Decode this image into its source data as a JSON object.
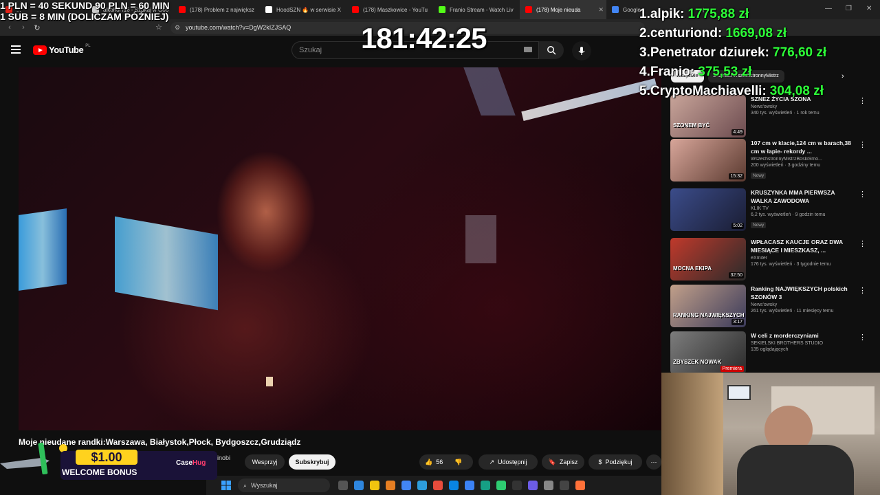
{
  "browser": {
    "tabs": [
      {
        "label": "...",
        "color": "#e62117",
        "active": false
      },
      {
        "label": "alkohol f16 - Szukaj w Goo",
        "color": "#cfcfcf",
        "active": false
      },
      {
        "label": "(178) Problem z największ",
        "color": "#ff0000",
        "active": false
      },
      {
        "label": "HoodSZN 🔥 w serwisie X",
        "color": "#ffffff",
        "active": false
      },
      {
        "label": "(178) Maszkowice - YouTu",
        "color": "#ff0000",
        "active": false
      },
      {
        "label": "Franio Stream - Watch Liv",
        "color": "#53fc18",
        "active": false
      },
      {
        "label": "(178) Moje nieuda",
        "color": "#ff0000",
        "active": true
      },
      {
        "label": "Google",
        "color": "#4285f4",
        "active": false
      }
    ],
    "new_tab": "+",
    "url": "youtube.com/watch?v=DgW2kIZJSAQ"
  },
  "youtube": {
    "logo": "YouTube",
    "region": "PL",
    "search_placeholder": "Szukaj",
    "video_title": "Moje nieudane randki:Warszawa, Białystok,Płock, Bydgoszcz,Grudziądz",
    "buttons": {
      "support": "Wesprzyj",
      "subscribe": "Subskrybuj",
      "likes": "56",
      "share": "Udostępnij",
      "save": "Zapisz",
      "thanks": "Podziękuj"
    },
    "channel_suffix": "inobi"
  },
  "sidebar": {
    "chips": [
      "Wszystkie",
      "Z kanału WszechstronnyMistrz"
    ],
    "recommendations": [
      {
        "title": "SZNEZ ŻYCIA SZONA",
        "channel": "News'owsky",
        "meta": "340 tys. wyświetleń · 1 rok temu",
        "duration": "4:49",
        "new": false,
        "thumb_label": "SZONEM BYĆ",
        "thumb_colors": [
          "#c9a59a",
          "#6c4b4f"
        ]
      },
      {
        "title": "107 cm w klacie,124 cm w barach,38 cm w łapie- rekordy ...",
        "channel": "WszechstronnyMistrzBoskiSmo...",
        "meta": "200 wyświetleń · 3 godziny temu",
        "duration": "15:32",
        "new": true,
        "thumb_label": "",
        "thumb_colors": [
          "#d8a69a",
          "#5b3a30"
        ]
      },
      {
        "title": "KRUSZYNKA MMA PIERWSZA WALKA ZAWODOWA",
        "channel": "KLIK TV",
        "meta": "6,2 tys. wyświetleń · 9 godzin temu",
        "duration": "5:02",
        "new": true,
        "thumb_label": "",
        "thumb_colors": [
          "#3b4c8a",
          "#1a1d33"
        ]
      },
      {
        "title": "WPŁACASZ KAUCJE ORAZ DWA MIESIĄCE I MIESZKASZ, ...",
        "channel": "eXmiter",
        "meta": "176 tys. wyświetleń · 3 tygodnie temu",
        "duration": "32:50",
        "new": false,
        "thumb_label": "MOCNA EKIPA",
        "thumb_colors": [
          "#c0392b",
          "#2b2b2b"
        ]
      },
      {
        "title": "Ranking NAJWIĘKSZYCH polskich SZONÓW 3",
        "channel": "News'owsky",
        "meta": "261 tys. wyświetleń · 11 miesięcy temu",
        "duration": "3:17",
        "new": false,
        "thumb_label": "RANKING NAJWIĘKSZYCH SZONÓW",
        "thumb_colors": [
          "#c2a08a",
          "#3a3a5a"
        ]
      },
      {
        "title": "W celi z morderczyniami",
        "channel": "SEKIELSKI BROTHERS STUDIO",
        "meta": "135 oglądających",
        "duration": "Premiera",
        "new": false,
        "thumb_label": "ZBYSZEK NOWAK",
        "thumb_colors": [
          "#7d7d7d",
          "#2a2a2a"
        ]
      }
    ]
  },
  "overlays": {
    "rates_line1": "1 PLN = 40 SEKUND 90 PLN = 60 MIN",
    "rates_line2": "1 SUB = 8 MIN (DOLICZAM PÓŹNIEJ)",
    "timer": "181:42:25",
    "donors": [
      {
        "rank": "1.",
        "name": "alpik:",
        "amount": "1775,88 zł"
      },
      {
        "rank": "2.",
        "name": "centuriond:",
        "amount": "1669,08 zł"
      },
      {
        "rank": "3.",
        "name": "Penetrator dziurek:",
        "amount": "776,60 zł"
      },
      {
        "rank": "4.",
        "name": "Franio:",
        "amount": "375,53 zł"
      },
      {
        "rank": "5.",
        "name": "CryptoMachiavelli:",
        "amount": "304,08 zł"
      }
    ],
    "promo": {
      "price": "$1.00",
      "bonus": "WELCOME BONUS",
      "brand_a": "Case",
      "brand_b": "Hug"
    }
  },
  "taskbar": {
    "search": "Wyszukaj",
    "icons": [
      "#555555",
      "#2e86de",
      "#f1c40f",
      "#e67e22",
      "#4285f4",
      "#2d9cdb",
      "#e74c3c",
      "#0984e3",
      "#3b82f6",
      "#16a085",
      "#2ecc71",
      "#333333",
      "#6c5ce7",
      "#888888",
      "#444444",
      "#ff7139"
    ]
  },
  "colors": {
    "youtube_red": "#ff0000",
    "donor_amount": "#2dff38",
    "promo_yellow": "#ffd21e"
  }
}
